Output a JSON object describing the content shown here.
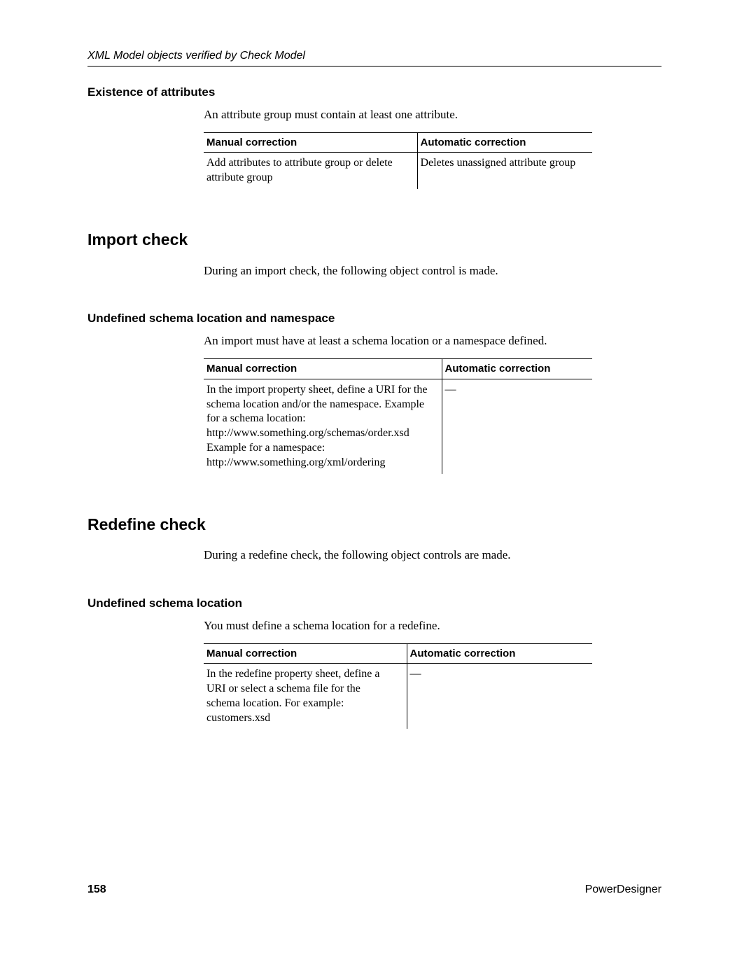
{
  "runningHead": "XML Model objects verified by Check Model",
  "sections": {
    "s1": {
      "h3": "Existence of attributes",
      "p": "An attribute group must contain at least one attribute.",
      "th1": "Manual correction",
      "th2": "Automatic correction",
      "td1": "Add attributes to attribute group or delete attribute group",
      "td2": "Deletes unassigned attribute group"
    },
    "s2": {
      "h2": "Import check",
      "p": "During an import check, the following object control is made.",
      "h3": "Undefined schema location and namespace",
      "p2": "An import must have at least a schema location or a namespace defined.",
      "th1": "Manual correction",
      "th2": "Automatic correction",
      "td1": "In the import property sheet, define a URI for the schema location and/or the namespace. Example for a schema location: http://www.something.org/schemas/order.xsd Example for a namespace: http://www.something.org/xml/ordering",
      "td2": "—"
    },
    "s3": {
      "h2": "Redefine check",
      "p": "During a redefine check, the following object controls are made.",
      "h3": "Undefined schema location",
      "p2": "You must define a schema location for a redefine.",
      "th1": "Manual correction",
      "th2": "Automatic correction",
      "td1": "In the redefine property sheet, define a URI or select a schema file for the schema location.  For example: customers.xsd",
      "td2": "—"
    }
  },
  "footer": {
    "page": "158",
    "product": "PowerDesigner"
  }
}
